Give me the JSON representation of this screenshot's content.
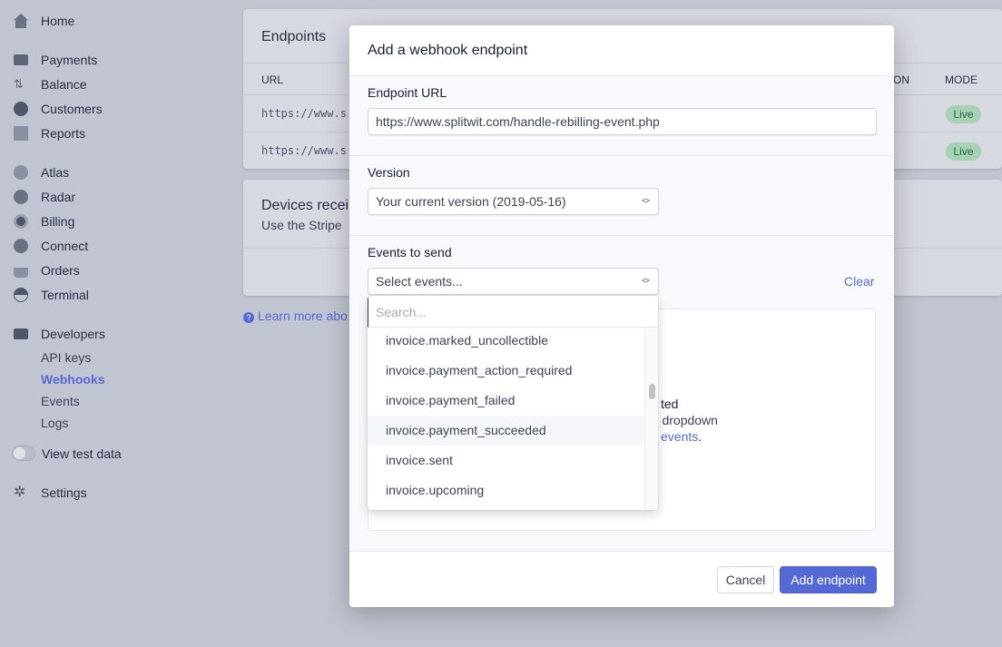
{
  "sidebar": {
    "items": [
      {
        "label": "Home",
        "icon": "home-icon"
      },
      {
        "label": "Payments",
        "icon": "payments-icon"
      },
      {
        "label": "Balance",
        "icon": "balance-icon"
      },
      {
        "label": "Customers",
        "icon": "customers-icon"
      },
      {
        "label": "Reports",
        "icon": "reports-icon"
      },
      {
        "label": "Atlas",
        "icon": "atlas-icon"
      },
      {
        "label": "Radar",
        "icon": "radar-icon"
      },
      {
        "label": "Billing",
        "icon": "billing-icon"
      },
      {
        "label": "Connect",
        "icon": "connect-icon"
      },
      {
        "label": "Orders",
        "icon": "orders-icon"
      },
      {
        "label": "Terminal",
        "icon": "terminal-icon"
      },
      {
        "label": "Developers",
        "icon": "developers-icon"
      }
    ],
    "developer_sub": [
      "API keys",
      "Webhooks",
      "Events",
      "Logs"
    ],
    "active_sub": "Webhooks",
    "test_data_label": "View test data",
    "settings_label": "Settings"
  },
  "endpoints": {
    "title": "Endpoints",
    "col_url": "URL",
    "col_version_partial": "ON",
    "col_mode": "MODE",
    "rows": [
      {
        "url": "https://www.s",
        "mode": "Live"
      },
      {
        "url": "https://www.s",
        "mode": "Live"
      }
    ]
  },
  "devices": {
    "title": "Devices recei",
    "desc": "Use the Stripe"
  },
  "learn_more": "Learn more abo",
  "modal": {
    "title": "Add a webhook endpoint",
    "url_label": "Endpoint URL",
    "url_value": "https://www.splitwit.com/handle-rebilling-event.php",
    "version_label": "Version",
    "version_value": "Your current version (2019-05-16)",
    "events_label": "Events to send",
    "events_placeholder": "Select events...",
    "clear": "Clear",
    "search_placeholder": "Search...",
    "options": [
      "invoice.marked_uncollectible",
      "invoice.payment_action_required",
      "invoice.payment_failed",
      "invoice.payment_succeeded",
      "invoice.sent",
      "invoice.upcoming"
    ],
    "hovered_option": "invoice.payment_succeeded",
    "empty_fragments": [
      "ted",
      "he dropdown",
      "events",
      "."
    ],
    "cancel": "Cancel",
    "add": "Add endpoint"
  },
  "colors": {
    "accent": "#5469d4",
    "live_bg": "#a6d1b2",
    "live_text": "#1e6940"
  }
}
